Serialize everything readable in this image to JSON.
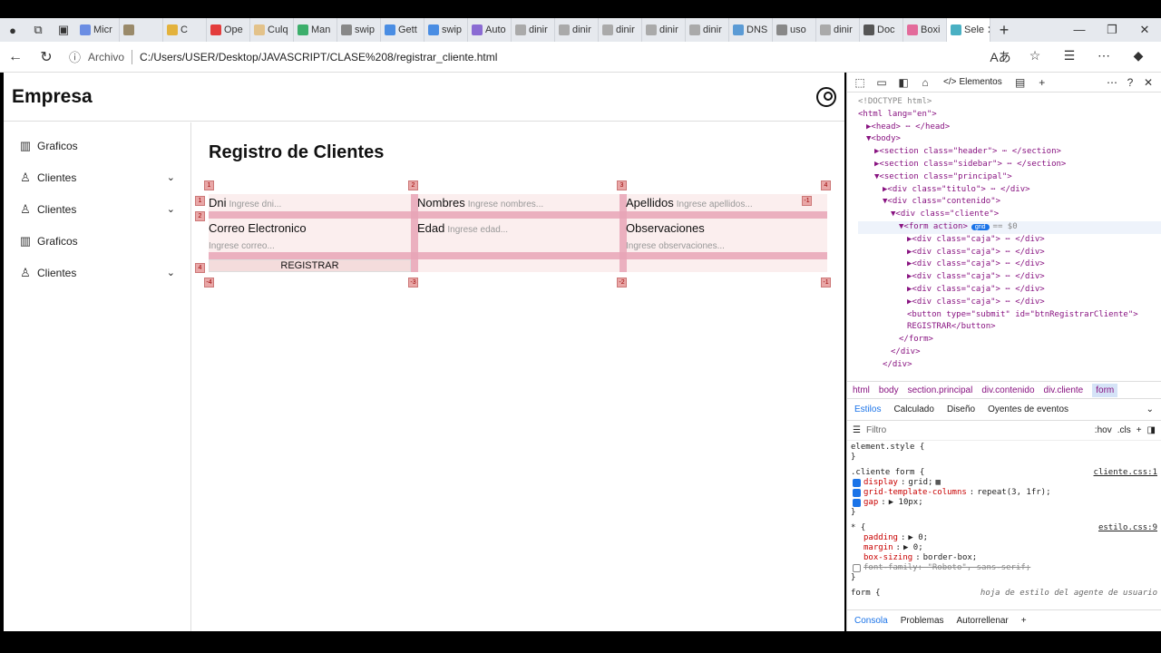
{
  "browser": {
    "tabs": [
      {
        "label": "Micr",
        "color": "#6b8de3"
      },
      {
        "label": "",
        "color": "#9a8a6a"
      },
      {
        "label": "C",
        "color": "#e3b23c"
      },
      {
        "label": "Ope",
        "color": "#e33c3c"
      },
      {
        "label": "Culq",
        "color": "#e3c28a"
      },
      {
        "label": "Man",
        "color": "#3cae6b"
      },
      {
        "label": "swip",
        "color": "#888888"
      },
      {
        "label": "Gett",
        "color": "#4a8de3"
      },
      {
        "label": "swip",
        "color": "#4a8de3"
      },
      {
        "label": "Auto",
        "color": "#8a6bd3"
      },
      {
        "label": "dinir",
        "color": "#aaaaaa"
      },
      {
        "label": "dinir",
        "color": "#aaaaaa"
      },
      {
        "label": "dinir",
        "color": "#aaaaaa"
      },
      {
        "label": "dinir",
        "color": "#aaaaaa"
      },
      {
        "label": "dinir",
        "color": "#aaaaaa"
      },
      {
        "label": "DNS",
        "color": "#5b9bd5"
      },
      {
        "label": "uso",
        "color": "#888888"
      },
      {
        "label": "dinir",
        "color": "#aaaaaa"
      },
      {
        "label": "Doc",
        "color": "#555555"
      },
      {
        "label": "Boxi",
        "color": "#e36b9b"
      },
      {
        "label": "Sele",
        "color": "#4ab0c3"
      }
    ],
    "active_tab_close": "✕",
    "new_tab": "+",
    "address_scheme": "Archivo",
    "url": "C:/Users/USER/Desktop/JAVASCRIPT/CLASE%208/registrar_cliente.html"
  },
  "page": {
    "brand": "Empresa",
    "sidebar": [
      {
        "label": "Graficos",
        "icon": "chart-icon",
        "expand": false
      },
      {
        "label": "Clientes",
        "icon": "person-icon",
        "expand": true
      },
      {
        "label": "Clientes",
        "icon": "person-icon",
        "expand": true
      },
      {
        "label": "Graficos",
        "icon": "chart-icon",
        "expand": false
      },
      {
        "label": "Clientes",
        "icon": "person-icon",
        "expand": true
      }
    ],
    "title": "Registro de Clientes",
    "form": {
      "dni_label": "Dni",
      "dni_ph": "Ingrese dni...",
      "nombres_label": "Nombres",
      "nombres_ph": "Ingrese nombres...",
      "apellidos_label": "Apellidos",
      "apellidos_ph": "Ingrese apellidos...",
      "correo_label": "Correo Electronico",
      "correo_ph": "Ingrese correo...",
      "edad_label": "Edad",
      "edad_ph": "Ingrese edad...",
      "obs_label": "Observaciones",
      "obs_ph": "Ingrese observaciones...",
      "button": "REGISTRAR"
    },
    "grid_numbers": {
      "top": [
        "1",
        "2",
        "3",
        "4"
      ],
      "left": [
        "1",
        "2",
        "4"
      ],
      "bottom": [
        "-4",
        "-3",
        "-2",
        "-1"
      ],
      "right": [
        "-1"
      ]
    }
  },
  "devtools": {
    "elements_tab": "Elementos",
    "dom_lines": [
      "<!DOCTYPE html>",
      "<html lang=\"en\">",
      "▶<head> ⋯ </head>",
      "▼<body>",
      "▶<section class=\"header\"> ⋯ </section>",
      "▶<section class=\"sidebar\"> ⋯ </section>",
      "▼<section class=\"principal\">",
      "▶<div class=\"titulo\"> ⋯ </div>",
      "▼<div class=\"contenido\">",
      "▼<div class=\"cliente\">",
      "▼<form action>",
      "▶<div class=\"caja\"> ⋯ </div>",
      "▶<div class=\"caja\"> ⋯ </div>",
      "▶<div class=\"caja\"> ⋯ </div>",
      "▶<div class=\"caja\"> ⋯ </div>",
      "▶<div class=\"caja\"> ⋯ </div>",
      "▶<div class=\"caja\"> ⋯ </div>",
      "<button type=\"submit\" id=\"btnRegistrarCliente\">",
      "REGISTRAR</button>",
      "</form>",
      "</div>",
      "</div>"
    ],
    "grid_badge": "grid",
    "dollar": "== $0",
    "breadcrumbs": [
      "html",
      "body",
      "section.principal",
      "div.contenido",
      "div.cliente",
      "form"
    ],
    "style_tabs": [
      "Estilos",
      "Calculado",
      "Diseño",
      "Oyentes de eventos"
    ],
    "filter_ph": "Filtro",
    "hov": ":hov",
    "cls": ".cls",
    "rules": {
      "element_style": "element.style {",
      "close": "}",
      "cliente_sel": ".cliente form {",
      "cliente_src": "cliente.css:1",
      "p1n": "display",
      "p1v": "grid;",
      "p2n": "grid-template-columns",
      "p2v": "repeat(3, 1fr);",
      "p3n": "gap",
      "p3v": "▶ 10px;",
      "star_sel": "* {",
      "star_src": "estilo.css:9",
      "s1n": "padding",
      "s1v": "▶ 0;",
      "s2n": "margin",
      "s2v": "▶ 0;",
      "s3n": "box-sizing",
      "s3v": "border-box;",
      "s4": "font-family: \"Roboto\", sans-serif;",
      "form_sel": "form {",
      "form_src": "hoja de estilo del agente de usuario"
    },
    "drawer": [
      "Consola",
      "Problemas",
      "Autorrellenar"
    ]
  }
}
